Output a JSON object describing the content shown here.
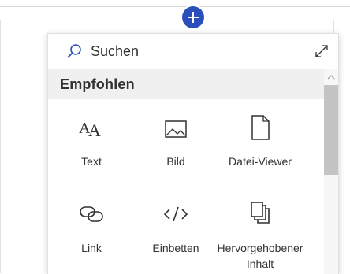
{
  "add_button": {
    "icon": "plus-icon"
  },
  "panel": {
    "search": {
      "label": "Suchen",
      "icon": "search-icon"
    },
    "expand": {
      "icon": "expand-icon"
    },
    "section": {
      "title": "Empfohlen"
    },
    "items": [
      {
        "label": "Text",
        "icon": "text-icon"
      },
      {
        "label": "Bild",
        "icon": "image-icon"
      },
      {
        "label": "Datei-Viewer",
        "icon": "file-icon"
      },
      {
        "label": "Link",
        "icon": "link-icon"
      },
      {
        "label": "Einbetten",
        "icon": "embed-icon"
      },
      {
        "label": "Hervorgehobener Inhalt",
        "icon": "highlighted-content-icon"
      }
    ]
  },
  "colors": {
    "accent": "#2b4fba",
    "section_bg": "#f0f0f0",
    "text": "#323130"
  }
}
